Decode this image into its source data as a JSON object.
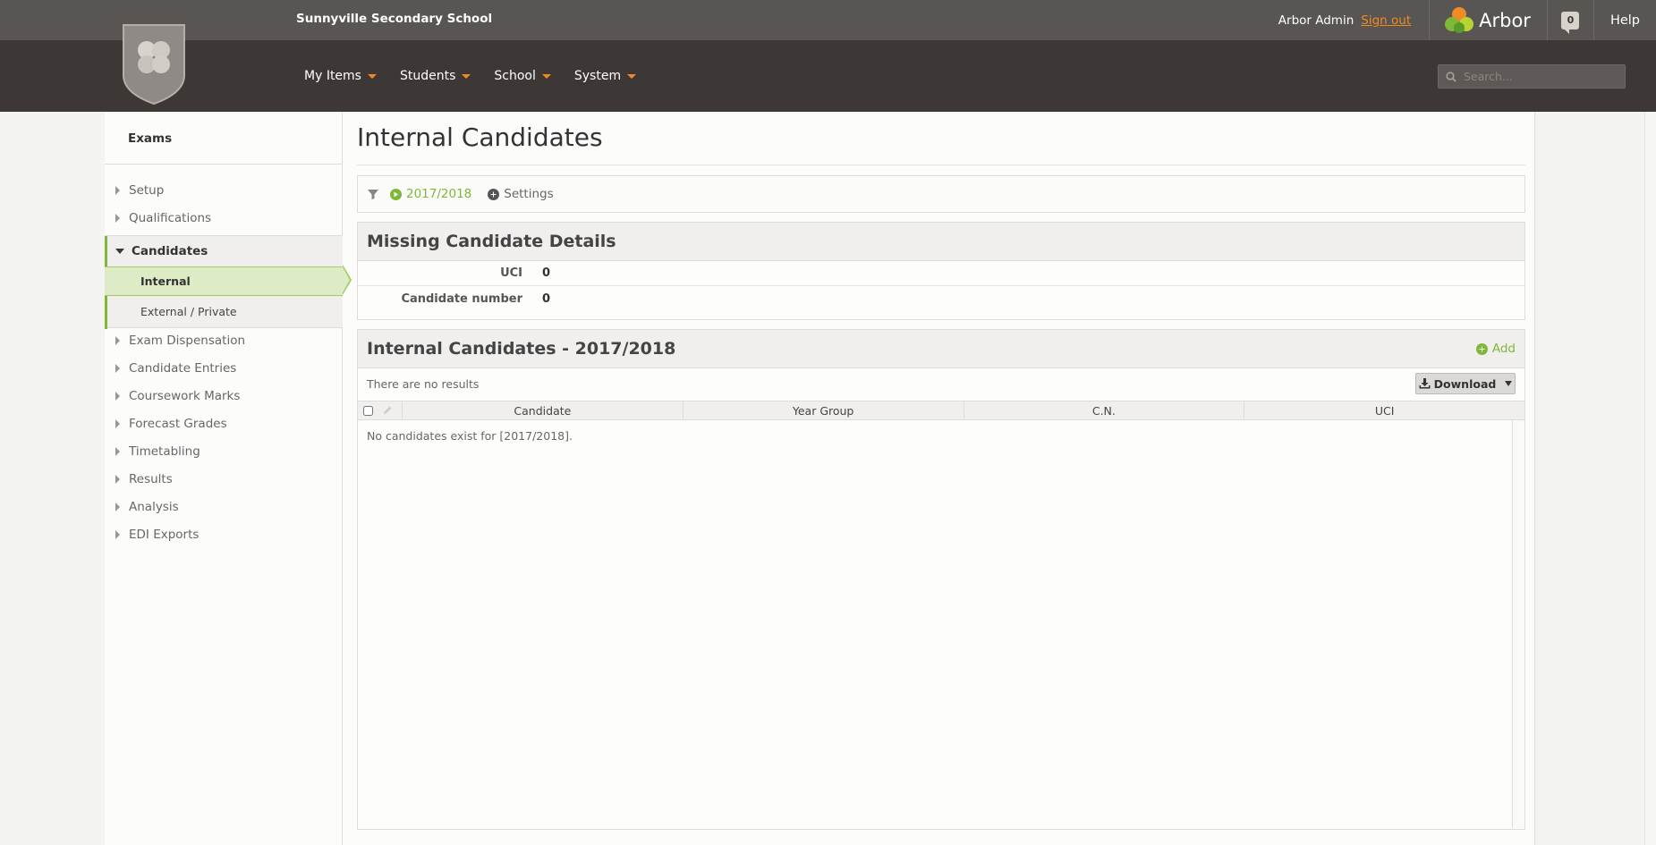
{
  "header": {
    "school_name": "Sunnyville Secondary School",
    "user_name": "Arbor Admin",
    "sign_out": "Sign out",
    "brand": "Arbor",
    "notifications": "0",
    "help": "Help",
    "search_placeholder": "Search..."
  },
  "menu": {
    "items": [
      {
        "label": "My Items"
      },
      {
        "label": "Students"
      },
      {
        "label": "School"
      },
      {
        "label": "System"
      }
    ]
  },
  "sidebar": {
    "title": "Exams",
    "items_top": [
      {
        "label": "Setup"
      },
      {
        "label": "Qualifications"
      }
    ],
    "group": {
      "label": "Candidates",
      "sub": [
        {
          "label": "Internal"
        },
        {
          "label": "External / Private"
        }
      ]
    },
    "items_bottom": [
      {
        "label": "Exam Dispensation"
      },
      {
        "label": "Candidate Entries"
      },
      {
        "label": "Coursework Marks"
      },
      {
        "label": "Forecast Grades"
      },
      {
        "label": "Timetabling"
      },
      {
        "label": "Results"
      },
      {
        "label": "Analysis"
      },
      {
        "label": "EDI Exports"
      }
    ]
  },
  "page": {
    "title": "Internal Candidates",
    "filter": {
      "year": "2017/2018",
      "settings": "Settings"
    },
    "missing": {
      "title": "Missing Candidate Details",
      "rows": [
        {
          "label": "UCI",
          "value": "0"
        },
        {
          "label": "Candidate number",
          "value": "0"
        }
      ]
    },
    "list": {
      "title": "Internal Candidates - 2017/2018",
      "add": "Add",
      "no_results": "There are no results",
      "download": "Download",
      "columns": [
        "Candidate",
        "Year Group",
        "C.N.",
        "UCI"
      ],
      "empty": "No candidates exist for [2017/2018]."
    }
  },
  "colors": {
    "accent_green": "#7fb737",
    "accent_orange": "#f08a24",
    "nav_dark": "#3d3836",
    "topbar": "#595552"
  }
}
